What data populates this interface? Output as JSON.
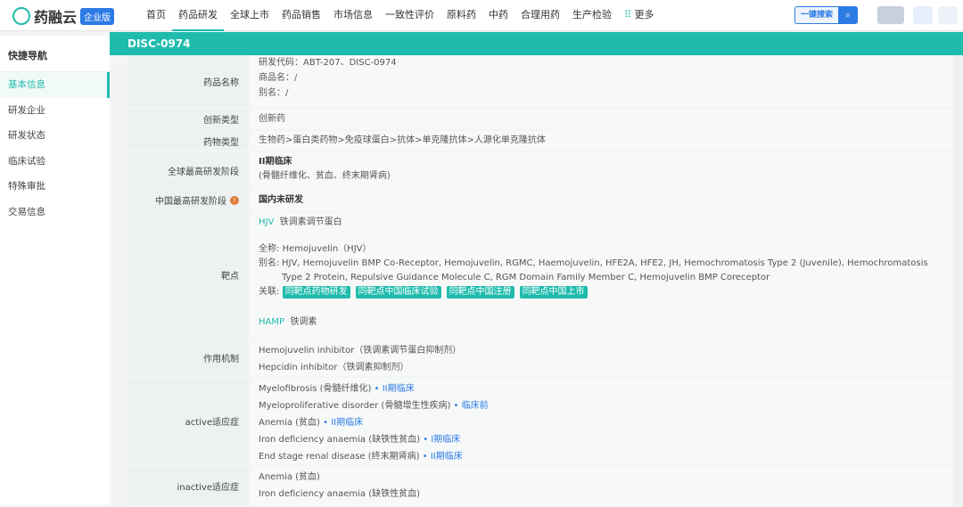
{
  "header": {
    "logo": "药融云",
    "edition": "企业版",
    "nav": [
      "首页",
      "药品研发",
      "全球上市",
      "药品销售",
      "市场信息",
      "一致性评价",
      "原料药",
      "中药",
      "合理用药",
      "生产检验",
      "更多"
    ],
    "search_label": "一键搜索"
  },
  "title": "DISC-0974",
  "sidebar": {
    "heading": "快捷导航",
    "items": [
      "基本信息",
      "研发企业",
      "研发状态",
      "临床试验",
      "特殊审批",
      "交易信息"
    ]
  },
  "rows": {
    "name": {
      "label": "药品名称",
      "code": "研发代码：ABT-207、DISC-0974",
      "trade": "商品名：/",
      "alias": "别名：/"
    },
    "innov": {
      "label": "创新类型",
      "value": "创新药"
    },
    "type": {
      "label": "药物类型",
      "value": "生物药>蛋白类药物>免疫球蛋白>抗体>单克隆抗体>人源化单克隆抗体"
    },
    "global": {
      "label": "全球最高研发阶段",
      "value": "II期临床",
      "note": "(骨髓纤维化、贫血、终末期肾病)"
    },
    "china": {
      "label": "中国最高研发阶段",
      "value": "国内未研发"
    },
    "target": {
      "label": "靶点",
      "t1_code": "HJV",
      "t1_name": "铁调素调节蛋白",
      "full_label": "全称:",
      "full": "Hemojuvelin（HJV）",
      "alias_label": "别名:",
      "alias": "HJV, Hemojuvelin BMP Co-Receptor, Hemojuvelin, RGMC, Haemojuvelin, HFE2A, HFE2, JH, Hemochromatosis Type 2 (Juvenile), Hemochromatosis Type 2 Protein, Repulsive Guidance Molecule C, RGM Domain Family Member C, Hemojuvelin BMP Coreceptor",
      "rel_label": "关联:",
      "tags": [
        "同靶点药物研发",
        "同靶点中国临床试验",
        "同靶点中国注册",
        "同靶点中国上市"
      ],
      "t2_code": "HAMP",
      "t2_name": "铁调素"
    },
    "mech": {
      "label": "作用机制",
      "items": [
        "Hemojuvelin inhibitor（铁调素调节蛋白抑制剂）",
        "Hepcidin inhibitor（铁调素抑制剂）"
      ]
    },
    "active": {
      "label": "active适应症",
      "items": [
        {
          "name": "Myelofibrosis (骨髓纤维化)",
          "stage": "• II期临床"
        },
        {
          "name": "Myeloproliferative disorder (骨髓增生性疾病)",
          "stage": "• 临床前"
        },
        {
          "name": "Anemia (贫血)",
          "stage": "• II期临床"
        },
        {
          "name": "Iron deficiency anaemia (缺铁性贫血)",
          "stage": "• I期临床"
        },
        {
          "name": "End stage renal disease (终末期肾病)",
          "stage": "• II期临床"
        }
      ]
    },
    "inactive": {
      "label": "inactive适应症",
      "items": [
        "Anemia (贫血)",
        "Iron deficiency anaemia (缺铁性贫血)"
      ]
    }
  }
}
